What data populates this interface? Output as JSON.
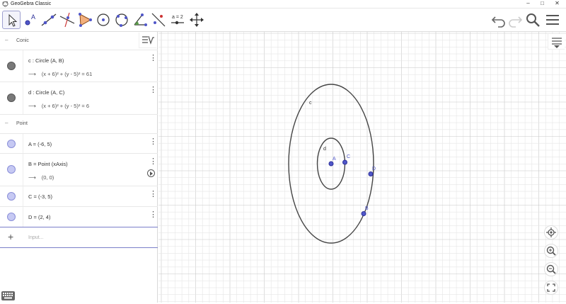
{
  "window": {
    "title": "GeoGebra Classic",
    "minimize": "–",
    "maximize": "□",
    "close": "✕"
  },
  "toolbar": {
    "tools": [
      {
        "name": "move-tool-icon",
        "selected": true
      },
      {
        "name": "point-tool-icon"
      },
      {
        "name": "line-tool-icon"
      },
      {
        "name": "perpendicular-line-tool-icon"
      },
      {
        "name": "polygon-tool-icon"
      },
      {
        "name": "circle-center-point-tool-icon"
      },
      {
        "name": "circle-three-points-tool-icon"
      },
      {
        "name": "angle-tool-icon"
      },
      {
        "name": "reflect-tool-icon"
      },
      {
        "name": "slider-tool-icon",
        "label": "a = 2"
      },
      {
        "name": "move-graphics-tool-icon"
      }
    ],
    "right": [
      "undo-icon",
      "redo-icon",
      "search-icon",
      "menu-icon"
    ]
  },
  "algebra": {
    "groups": [
      {
        "label": "Conic",
        "collapse": "–"
      },
      {
        "label": "Point",
        "collapse": "–"
      }
    ],
    "items": [
      {
        "definition": "c : Circle (A, B)",
        "output": "(x + 6)² + (y - 5)² = 61",
        "style": "dark",
        "menu": "⋮"
      },
      {
        "definition": "d : Circle (A, C)",
        "output": "(x + 6)² + (y - 5)² = 6",
        "style": "dark",
        "menu": "⋮"
      },
      {
        "definition": "A = (-6, 5)",
        "style": "light",
        "menu": "⋮"
      },
      {
        "definition": "B = Point (xAxis)",
        "output": "(0, 0)",
        "style": "light",
        "menu": "⋮"
      },
      {
        "definition": "C = (-3, 5)",
        "style": "light",
        "menu": "⋮"
      },
      {
        "definition": "D = (2, 4)",
        "style": "light",
        "menu": "⋮"
      }
    ],
    "output_arrow": "⟶",
    "input": {
      "plus": "+",
      "placeholder": "Input..."
    }
  },
  "graphics": {
    "labels": {
      "c": "c",
      "d": "d",
      "A": "A",
      "B": "B",
      "C": "C",
      "D": "D"
    },
    "colors": {
      "point_fill": "#5057c9",
      "point_stroke": "#2d3099",
      "curve": "#444444",
      "grid_minor": "#e6e6e6",
      "grid_major": "#c8c8c8",
      "accent": "#7b7fc9"
    },
    "buttons": [
      "standard-view-icon",
      "zoom-in-icon",
      "zoom-out-icon",
      "fullscreen-icon"
    ]
  }
}
